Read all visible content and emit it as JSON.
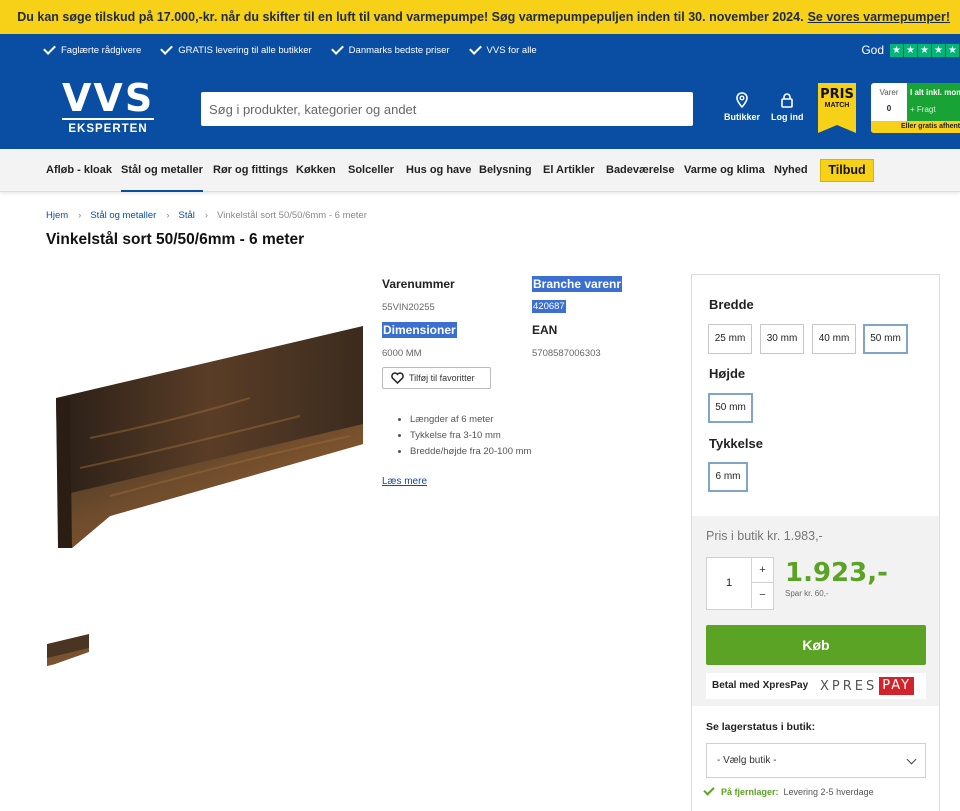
{
  "banner": {
    "text": "Du kan søge tilskud på 17.000,-kr. når du skifter til en luft til vand varmepumpe! Søg varmepumpepuljen inden til 30. november 2024.",
    "link": "Se vores varmepumper!"
  },
  "usps": [
    "Faglærte rådgivere",
    "GRATIS levering til alle butikker",
    "Danmarks bedste priser",
    "VVS for alle"
  ],
  "trustpilot": {
    "label": "God",
    "stars": 5,
    "color": "#00b67a"
  },
  "logo": {
    "top": "VVS",
    "bottom": "EKSPERTEN"
  },
  "search": {
    "placeholder": "Søg i produkter, kategorier og andet"
  },
  "header_links": {
    "stores": "Butikker",
    "login": "Log ind"
  },
  "prismatch": {
    "line1": "PRIS",
    "line2": "MATCH"
  },
  "cart": {
    "varer_label": "Varer",
    "count": "0",
    "total_label": "I alt inkl. moms",
    "fragt": "+ Fragt",
    "free_shipping": "Eller gratis afhentning"
  },
  "nav": {
    "items": [
      "Afløb - kloak",
      "Stål og metaller",
      "Rør og fittings",
      "Køkken",
      "Solceller",
      "Hus og have",
      "Belysning",
      "El Artikler",
      "Badeværelse",
      "Varme og klima",
      "Nyhed"
    ],
    "offer": "Tilbud"
  },
  "breadcrumb": [
    "Hjem",
    "Stål og metaller",
    "Stål",
    "Vinkelstål sort 50/50/6mm - 6 meter"
  ],
  "product": {
    "title": "Vinkelstål sort 50/50/6mm - 6 meter",
    "varenummer_label": "Varenummer",
    "varenummer": "55VIN20255",
    "branche_label": "Branche varenr",
    "branche": "420687",
    "dimensioner_label": "Dimensioner",
    "dimensioner": "6000 MM",
    "ean_label": "EAN",
    "ean": "5708587006303",
    "favorite_button": "Tilføj til favoritter",
    "bullets": [
      "Længder af 6 meter",
      "Tykkelse fra 3-10 mm",
      "Bredde/højde fra 20-100 mm"
    ],
    "read_more": "Læs mere"
  },
  "options": {
    "bredde_label": "Bredde",
    "bredde": [
      "25 mm",
      "30 mm",
      "40 mm",
      "50 mm"
    ],
    "bredde_selected": "50 mm",
    "hojde_label": "Højde",
    "hojde": [
      "50 mm"
    ],
    "tykkelse_label": "Tykkelse",
    "tykkelse": [
      "6 mm"
    ]
  },
  "pricing": {
    "store_price": "Pris i butik kr. 1.983,-",
    "quantity": "1",
    "plus": "+",
    "minus": "−",
    "price": "1.923,-",
    "saving": "Spar kr. 60,-",
    "buy": "Køb",
    "xpres_text": "Betal med XpresPay",
    "xpres_logo_a": "XPRES",
    "xpres_logo_b": "PAY"
  },
  "stock": {
    "label": "Se lagerstatus i butik:",
    "select": "- Vælg butik -",
    "status_label": "På fjernlager:",
    "status_text": "Levering 2-5 hverdage"
  },
  "colors": {
    "brand_blue": "#0a4ea3",
    "yellow": "#f7d117",
    "green": "#5aa324",
    "highlight": "#3b6fd0"
  }
}
